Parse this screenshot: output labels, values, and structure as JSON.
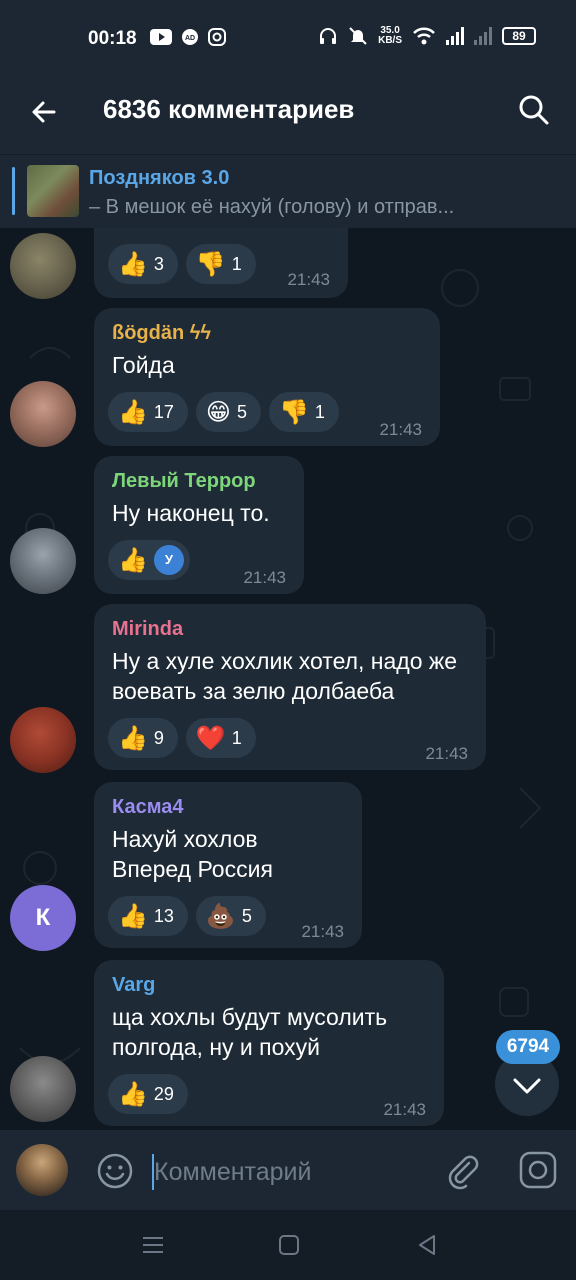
{
  "status_bar": {
    "time": "00:18",
    "network_speed_value": "35.0",
    "network_speed_unit": "KB/S",
    "battery": "89"
  },
  "header": {
    "title": "6836 комментариев",
    "back_icon": "arrow-left-icon",
    "search_icon": "search-icon"
  },
  "pinned": {
    "name": "Поздняков 3.0",
    "text": "– В мешок её нахуй (голову) и отправ..."
  },
  "messages": [
    {
      "sender": "",
      "text": "",
      "reactions": [
        {
          "emoji": "👍",
          "count": "3"
        },
        {
          "emoji": "👎",
          "count": "1"
        }
      ],
      "time": "21:43"
    },
    {
      "sender": "ßögdän ϟϟ",
      "sender_color": "#e8b24a",
      "text": "Гойда",
      "reactions": [
        {
          "emoji": "👍",
          "count": "17"
        },
        {
          "emoji": "😁",
          "count": "5"
        },
        {
          "emoji": "👎",
          "count": "1"
        }
      ],
      "time": "21:43"
    },
    {
      "sender": "Левый Террор",
      "sender_color": "#7ed67a",
      "text": "Ну наконец то.",
      "reactions": [
        {
          "emoji": "👍",
          "count": "У"
        }
      ],
      "time": "21:43"
    },
    {
      "sender": "Mirinda",
      "sender_color": "#e8728f",
      "text": "Ну а хуле хохлик хотел, надо же воевать за зелю долбаеба",
      "reactions": [
        {
          "emoji": "👍",
          "count": "9"
        },
        {
          "emoji": "❤️",
          "count": "1"
        }
      ],
      "time": "21:43"
    },
    {
      "sender": "Касма4",
      "sender_color": "#9b8cf0",
      "avatar_letter": "К",
      "text": "Нахуй хохлов Вперед Россия",
      "reactions": [
        {
          "emoji": "👍",
          "count": "13"
        },
        {
          "emoji": "💩",
          "count": "5"
        }
      ],
      "time": "21:43"
    },
    {
      "sender": "Varg",
      "sender_color": "#5aa7e8",
      "text": "ща хохлы будут мусолить полгода, ну и похуй",
      "reactions": [
        {
          "emoji": "👍",
          "count": "29"
        }
      ],
      "time": "21:43"
    }
  ],
  "unread_badge": "6794",
  "input": {
    "placeholder": "Комментарий"
  },
  "colors": {
    "background": "#0f1720",
    "bubble": "#1e2a36",
    "bars": "#1c2733",
    "accent": "#5aa7e8"
  }
}
